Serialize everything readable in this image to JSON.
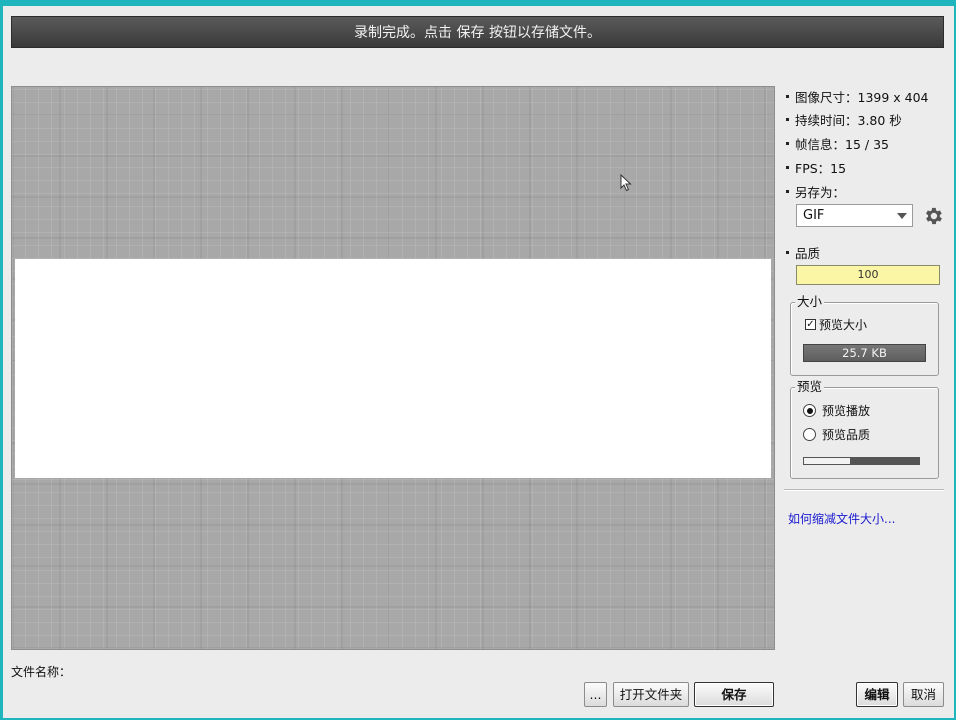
{
  "banner": {
    "message": "录制完成。点击 保存 按钮以存储文件。"
  },
  "info": {
    "image_size": "图像尺寸：1399 x 404",
    "duration": "持续时间：3.80 秒",
    "frame_info": "帧信息：15 / 35",
    "fps": "FPS：15",
    "save_as_label": "另存为："
  },
  "format": {
    "selected": "GIF"
  },
  "quality": {
    "label": "品质",
    "value": "100"
  },
  "size_group": {
    "title": "大小",
    "preview_size_label": "预览大小",
    "preview_size_checked": true,
    "estimated_size": "25.7 KB"
  },
  "preview_group": {
    "title": "预览",
    "play_label": "预览播放",
    "quality_label": "预览品质",
    "selected": "play",
    "slider_fraction": 0.4
  },
  "help": {
    "link": "如何缩减文件大小..."
  },
  "footer": {
    "filename_label": "文件名称：",
    "browse_label": "...",
    "open_folder_label": "打开文件夹",
    "save_label": "保存",
    "edit_label": "编辑",
    "cancel_label": "取消"
  },
  "colors": {
    "accent": "#1fb5bd",
    "banner_bg": "#444444",
    "quality_bar": "#fbf6a6",
    "link": "#1a1ad0"
  },
  "icons": [
    "gear-icon",
    "cursor-icon",
    "dropdown-arrow-icon",
    "check-icon"
  ]
}
